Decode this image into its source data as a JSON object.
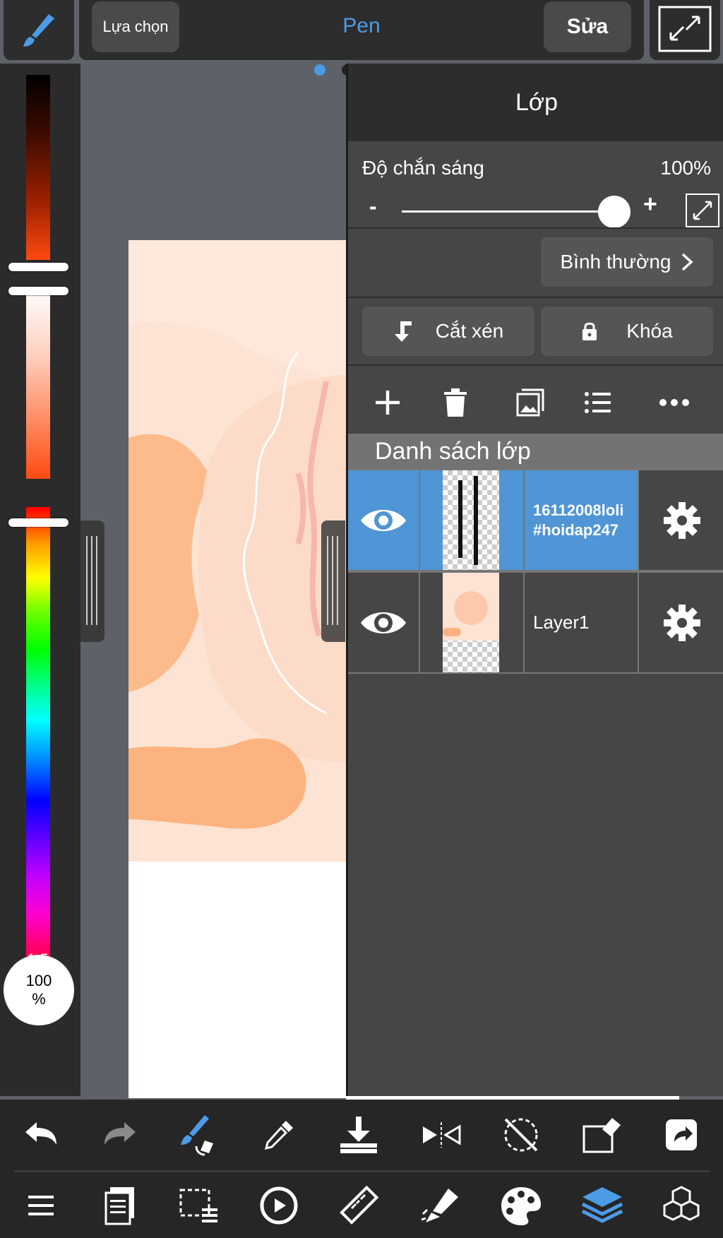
{
  "header": {
    "select_label": "Lựa chọn",
    "tool_name": "Pen",
    "edit_label": "Sửa"
  },
  "color_panel": {
    "brush_size": "1.5",
    "brush_size_unit": "px",
    "opacity_value": "100",
    "opacity_unit": "%"
  },
  "layer_panel": {
    "title": "Lớp",
    "opacity_label": "Độ chắn sáng",
    "opacity_value": "100%",
    "opacity_fraction": 1.0,
    "minus": "-",
    "plus": "+",
    "blend_mode": "Bình thường",
    "clip_label": "Cắt xén",
    "lock_label": "Khóa",
    "list_header": "Danh sách lớp",
    "layers": [
      {
        "name_line1": "16112008loli",
        "name_line2": "#hoidap247",
        "selected": true,
        "visible": true
      },
      {
        "name": "Layer1",
        "selected": false,
        "visible": true
      }
    ]
  },
  "colors": {
    "accent": "#4c9be6",
    "selected_layer": "#5095d5",
    "panel_bg": "#464646",
    "toolbar_bg": "#262626"
  },
  "toolbar_row1": [
    "undo-icon",
    "redo-icon",
    "brush-transform-icon",
    "eyedropper-icon",
    "import-icon",
    "flip-icon",
    "rotate-reset-icon",
    "eraser-icon",
    "share-icon"
  ],
  "toolbar_row2": [
    "menu-icon",
    "pages-icon",
    "selection-icon",
    "transform-icon",
    "ruler-icon",
    "fill-icon",
    "palette-icon",
    "layers-icon",
    "materials-icon"
  ]
}
